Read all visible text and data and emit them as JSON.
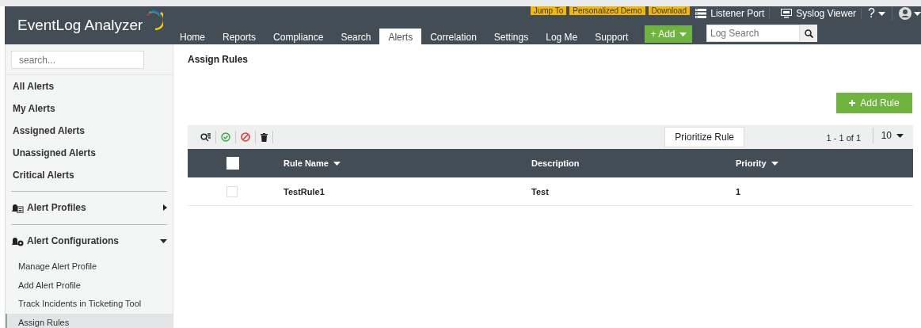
{
  "header": {
    "logo": "EventLog Analyzer",
    "promos": [
      "Jump To",
      "Personalized Demo",
      "Download"
    ],
    "tools": [
      {
        "kind": "listener",
        "label": "Listener Port"
      },
      {
        "kind": "syslog",
        "label": "Syslog Viewer"
      }
    ],
    "help": "?",
    "add_button": "+ Add",
    "log_search": {
      "placeholder": "Log Search"
    }
  },
  "nav": [
    {
      "label": "Home",
      "selected": false
    },
    {
      "label": "Reports",
      "selected": false
    },
    {
      "label": "Compliance",
      "selected": false
    },
    {
      "label": "Search",
      "selected": false
    },
    {
      "label": "Alerts",
      "selected": true
    },
    {
      "label": "Correlation",
      "selected": false
    },
    {
      "label": "Settings",
      "selected": false
    },
    {
      "label": "Log Me",
      "selected": false
    },
    {
      "label": "Support",
      "selected": false
    }
  ],
  "sidebar": {
    "search": {
      "placeholder": "search..."
    },
    "items": [
      {
        "label": "All Alerts"
      },
      {
        "label": "My Alerts"
      },
      {
        "label": "Assigned Alerts"
      },
      {
        "label": "Unassigned Alerts"
      },
      {
        "label": "Critical Alerts"
      }
    ],
    "groups": [
      {
        "label": "Alert Profiles",
        "kind": "profiles",
        "expanded": false
      },
      {
        "label": "Alert Configurations",
        "kind": "config",
        "expanded": true,
        "children": [
          {
            "label": "Manage Alert Profile",
            "selected": false
          },
          {
            "label": "Add Alert Profile",
            "selected": false
          },
          {
            "label": "Track Incidents in Ticketing Tool",
            "selected": false
          },
          {
            "label": "Assign Rules",
            "selected": true
          }
        ]
      }
    ]
  },
  "page": {
    "title": "Assign Rules",
    "add_rule": "Add Rule",
    "prioritize": "Prioritize Rule",
    "pagination": "1 - 1 of 1",
    "page_size": "10",
    "table": {
      "select_all": {
        "checked": false
      },
      "columns": [
        {
          "label": "Rule Name",
          "sortable": true
        },
        {
          "label": "Description",
          "sortable": false
        },
        {
          "label": "Priority",
          "sortable": true
        }
      ],
      "rows": [
        {
          "checked": false,
          "cells": [
            "TestRule1",
            "Test",
            "1"
          ]
        }
      ]
    }
  }
}
